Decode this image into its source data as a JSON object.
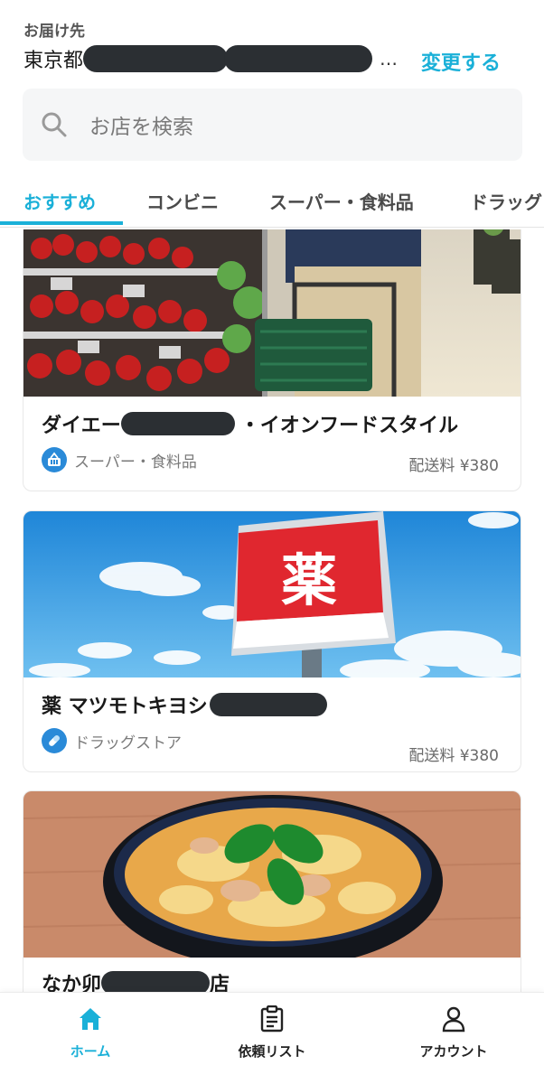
{
  "header": {
    "deliver_label": "お届け先",
    "address_visible": "東京都",
    "ellipsis": "…",
    "change_label": "変更する"
  },
  "search": {
    "placeholder": "お店を検索"
  },
  "tabs": [
    {
      "label": "おすすめ",
      "active": true
    },
    {
      "label": "コンビニ",
      "active": false
    },
    {
      "label": "スーパー・食料品",
      "active": false
    },
    {
      "label": "ドラッグ",
      "active": false
    }
  ],
  "stores": [
    {
      "name_prefix": "ダイエー",
      "name_suffix": "・イオンフードスタイル",
      "category": "スーパー・食料品",
      "category_icon": "basket-icon",
      "fee": "配送料 ¥380"
    },
    {
      "name_prefix": "薬 マツモトキヨシ",
      "name_suffix": "",
      "category": "ドラッグストア",
      "category_icon": "pill-icon",
      "fee": "配送料 ¥380",
      "sign_text": "薬"
    },
    {
      "name_prefix": "なか卯",
      "name_suffix": "店",
      "category": "",
      "fee": ""
    }
  ],
  "bottom_nav": [
    {
      "label": "ホーム",
      "icon": "home-icon",
      "active": true
    },
    {
      "label": "依頼リスト",
      "icon": "clipboard-icon",
      "active": false
    },
    {
      "label": "アカウント",
      "icon": "person-icon",
      "active": false
    }
  ],
  "colors": {
    "accent": "#1ab0d8",
    "redaction": "#2b2f33",
    "category_icon_bg": "#2a8ad8"
  }
}
